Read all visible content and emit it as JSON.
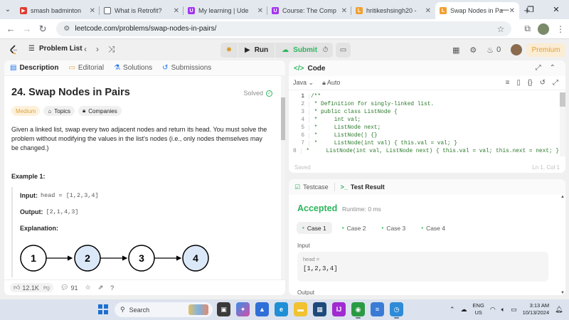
{
  "browser": {
    "tabs": [
      {
        "title": "smash badminton",
        "fav_color": "#e03b2f",
        "fav_glyph": "▶"
      },
      {
        "title": "What is Retrofit?",
        "fav_color": "#5f6368",
        "fav_glyph": "▢"
      },
      {
        "title": "My learning | Ude",
        "fav_color": "#a435f0",
        "fav_glyph": "U"
      },
      {
        "title": "Course: The Comp",
        "fav_color": "#a435f0",
        "fav_glyph": "U"
      },
      {
        "title": "hritikeshsingh20 -",
        "fav_color": "#f0a030",
        "fav_glyph": "L"
      },
      {
        "title": "Swap Nodes in Pa",
        "fav_color": "#f0a030",
        "fav_glyph": "L"
      }
    ],
    "url": "leetcode.com/problems/swap-nodes-in-pairs/"
  },
  "lc_nav": {
    "problem_list": "Problem List",
    "run": "Run",
    "submit": "Submit",
    "streak": "0",
    "premium": "Premium"
  },
  "left_panel": {
    "tabs": [
      "Description",
      "Editorial",
      "Solutions",
      "Submissions"
    ],
    "title": "24. Swap Nodes in Pairs",
    "status": "Solved",
    "badges": [
      "Medium",
      "Topics",
      "Companies"
    ],
    "description": "Given a linked list, swap every two adjacent nodes and return its head. You must solve the problem without modifying the values in the list's nodes (i.e., only nodes themselves may be changed.)",
    "example_title": "Example 1:",
    "input_label": "Input:",
    "input_value": "head = [1,2,3,4]",
    "output_label": "Output:",
    "output_value": "[2,1,4,3]",
    "explanation_label": "Explanation:",
    "diagram_nodes": [
      "1",
      "2",
      "3",
      "4"
    ],
    "likes": "12.1K",
    "comments": "91"
  },
  "code_panel": {
    "title": "Code",
    "language": "Java",
    "mode": "Auto",
    "lines": [
      {
        "n": "1",
        "text": "/**"
      },
      {
        "n": "2",
        "text": " * Definition for singly-linked list."
      },
      {
        "n": "3",
        "text": " * public class ListNode {"
      },
      {
        "n": "4",
        "text": " *     int val;"
      },
      {
        "n": "5",
        "text": " *     ListNode next;"
      },
      {
        "n": "6",
        "text": " *     ListNode() {}"
      },
      {
        "n": "7",
        "text": " *     ListNode(int val) { this.val = val; }"
      },
      {
        "n": "8",
        "text": " *     ListNode(int val, ListNode next) { this.val = val; this.next = next; }"
      }
    ],
    "saved": "Saved",
    "cursor": "Ln 1, Col 1"
  },
  "result_panel": {
    "tabs": [
      "Testcase",
      "Test Result"
    ],
    "status": "Accepted",
    "runtime": "Runtime: 0 ms",
    "cases": [
      "Case 1",
      "Case 2",
      "Case 3",
      "Case 4"
    ],
    "input_label": "Input",
    "var_name": "head =",
    "var_value": "[1,2,3,4]",
    "output_label": "Output"
  },
  "taskbar": {
    "search": "Search",
    "lang_line1": "ENG",
    "lang_line2": "US",
    "time": "3:13 AM",
    "date": "10/13/2024"
  }
}
